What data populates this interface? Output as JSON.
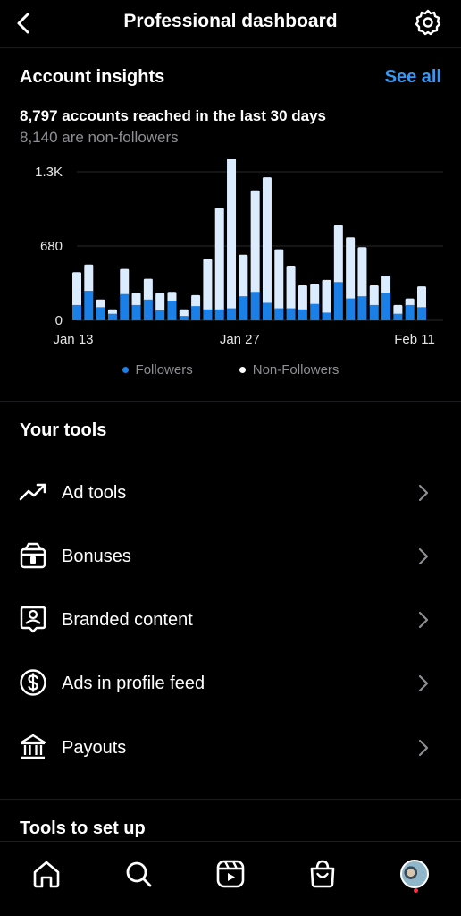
{
  "header": {
    "title": "Professional dashboard"
  },
  "insights": {
    "title": "Account insights",
    "see_all": "See all",
    "reach_text": "8,797 accounts reached in the last 30 days",
    "non_followers_text": "8,140 are non-followers"
  },
  "chart_data": {
    "type": "bar",
    "stacked": true,
    "y_ticks": [
      "0",
      "680",
      "1.3K"
    ],
    "ylim": [
      0,
      1360
    ],
    "x_tick_labels": [
      "Jan 13",
      "Jan 27",
      "Feb 11"
    ],
    "series": [
      {
        "name": "Followers",
        "color": "#1a7fe6",
        "values": [
          140,
          270,
          120,
          60,
          240,
          140,
          190,
          90,
          180,
          40,
          130,
          100,
          100,
          110,
          220,
          260,
          160,
          110,
          110,
          100,
          150,
          70,
          350,
          200,
          220,
          140,
          250,
          60,
          140,
          120
        ]
      },
      {
        "name": "Non-Followers",
        "color": "#dcecff",
        "values": [
          300,
          240,
          70,
          40,
          230,
          110,
          190,
          160,
          80,
          60,
          100,
          460,
          930,
          1540,
          380,
          930,
          1150,
          540,
          390,
          220,
          180,
          300,
          520,
          560,
          450,
          180,
          160,
          80,
          60,
          190
        ]
      }
    ],
    "grid": true
  },
  "legend": {
    "followers": "Followers",
    "non_followers": "Non-Followers"
  },
  "tools": {
    "title": "Your tools",
    "items": [
      {
        "label": "Ad tools",
        "icon": "trending-up-icon"
      },
      {
        "label": "Bonuses",
        "icon": "gift-box-icon"
      },
      {
        "label": "Branded content",
        "icon": "branded-content-icon"
      },
      {
        "label": "Ads in profile feed",
        "icon": "dollar-circle-icon"
      },
      {
        "label": "Payouts",
        "icon": "bank-icon"
      }
    ]
  },
  "setup": {
    "title": "Tools to set up"
  },
  "colors": {
    "accent": "#3897f0",
    "followers": "#1a7fe6",
    "non_followers": "#dcecff",
    "notification": "#ff3040"
  }
}
